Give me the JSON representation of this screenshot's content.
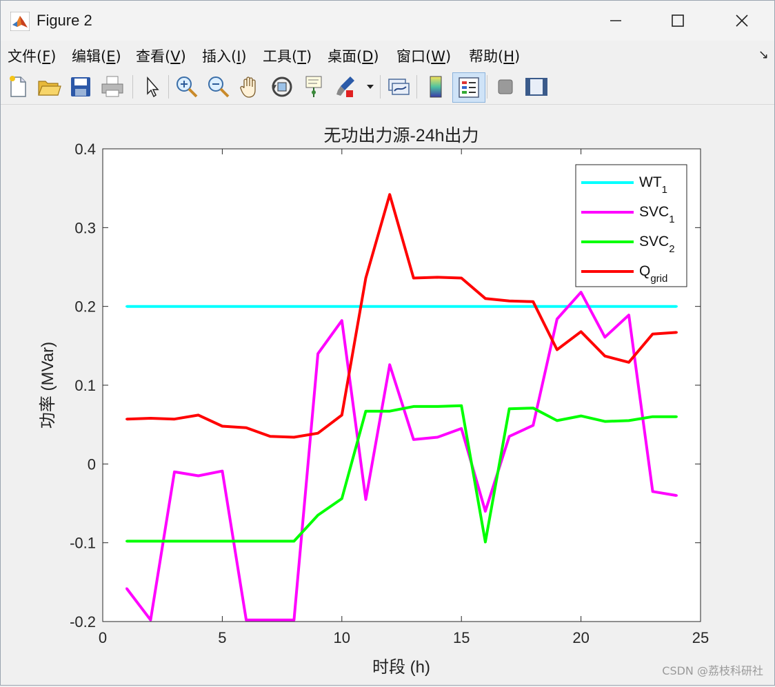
{
  "window": {
    "title": "Figure 2",
    "minimize_icon": "minimize-icon",
    "maximize_icon": "maximize-icon",
    "close_icon": "close-icon"
  },
  "menu": {
    "items": [
      {
        "pre": "文件(",
        "key": "F",
        "post": ")"
      },
      {
        "pre": "编辑(",
        "key": "E",
        "post": ")"
      },
      {
        "pre": "查看(",
        "key": "V",
        "post": ")"
      },
      {
        "pre": "插入(",
        "key": "I",
        "post": ")"
      },
      {
        "pre": "工具(",
        "key": "T",
        "post": ")"
      },
      {
        "pre": "桌面(",
        "key": "D",
        "post": ")"
      },
      {
        "pre": "窗口(",
        "key": "W",
        "post": ")"
      },
      {
        "pre": "帮助(",
        "key": "H",
        "post": ")"
      }
    ]
  },
  "toolbar": {
    "icons": [
      "new-file-icon",
      "open-folder-icon",
      "save-icon",
      "print-icon",
      "pointer-icon",
      "zoom-in-icon",
      "zoom-out-icon",
      "pan-hand-icon",
      "rotate-3d-icon",
      "data-cursor-icon",
      "brush-icon",
      "brush-dropdown-icon",
      "link-plot-icon",
      "colorbar-icon",
      "legend-icon",
      "hide-plot-tools-icon",
      "show-plot-tools-icon"
    ]
  },
  "chart_data": {
    "type": "line",
    "title": "无功出力源-24h出力",
    "xlabel": "时段 (h)",
    "ylabel": "功率 (MVar)",
    "xlim": [
      0,
      25
    ],
    "ylim": [
      -0.2,
      0.4
    ],
    "xticks": [
      0,
      5,
      10,
      15,
      20,
      25
    ],
    "yticks": [
      -0.2,
      -0.1,
      0,
      0.1,
      0.2,
      0.3,
      0.4
    ],
    "xtick_labels": [
      "0",
      "5",
      "10",
      "15",
      "20",
      "25"
    ],
    "ytick_labels": [
      "-0.2",
      "-0.1",
      "0",
      "0.1",
      "0.2",
      "0.3",
      "0.4"
    ],
    "grid": false,
    "legend_position": "top-right",
    "x": [
      1,
      2,
      3,
      4,
      5,
      6,
      7,
      8,
      9,
      10,
      11,
      12,
      13,
      14,
      15,
      16,
      17,
      18,
      19,
      20,
      21,
      22,
      23,
      24
    ],
    "series": [
      {
        "name": "WT",
        "sub": "1",
        "color": "#00ffff",
        "values": [
          0.2,
          0.2,
          0.2,
          0.2,
          0.2,
          0.2,
          0.2,
          0.2,
          0.2,
          0.2,
          0.2,
          0.2,
          0.2,
          0.2,
          0.2,
          0.2,
          0.2,
          0.2,
          0.2,
          0.2,
          0.2,
          0.2,
          0.2,
          0.2
        ]
      },
      {
        "name": "SVC",
        "sub": "1",
        "color": "#ff00ff",
        "values": [
          -0.158,
          -0.198,
          -0.01,
          -0.015,
          -0.009,
          -0.198,
          -0.198,
          -0.198,
          0.14,
          0.182,
          -0.045,
          0.126,
          0.031,
          0.034,
          0.045,
          -0.06,
          0.035,
          0.049,
          0.184,
          0.218,
          0.161,
          0.189,
          -0.035,
          -0.04
        ]
      },
      {
        "name": "SVC",
        "sub": "2",
        "color": "#00ff00",
        "values": [
          -0.098,
          -0.098,
          -0.098,
          -0.098,
          -0.098,
          -0.098,
          -0.098,
          -0.098,
          -0.065,
          -0.044,
          0.067,
          0.067,
          0.073,
          0.073,
          0.074,
          -0.099,
          0.07,
          0.071,
          0.055,
          0.061,
          0.054,
          0.055,
          0.06,
          0.06
        ]
      },
      {
        "name": "Q",
        "sub": "grid",
        "color": "#ff0000",
        "values": [
          0.057,
          0.058,
          0.057,
          0.062,
          0.048,
          0.046,
          0.035,
          0.034,
          0.039,
          0.062,
          0.236,
          0.342,
          0.236,
          0.237,
          0.236,
          0.21,
          0.207,
          0.206,
          0.145,
          0.168,
          0.137,
          0.129,
          0.165,
          0.167
        ]
      }
    ]
  },
  "watermark": "CSDN @荔枝科研社"
}
